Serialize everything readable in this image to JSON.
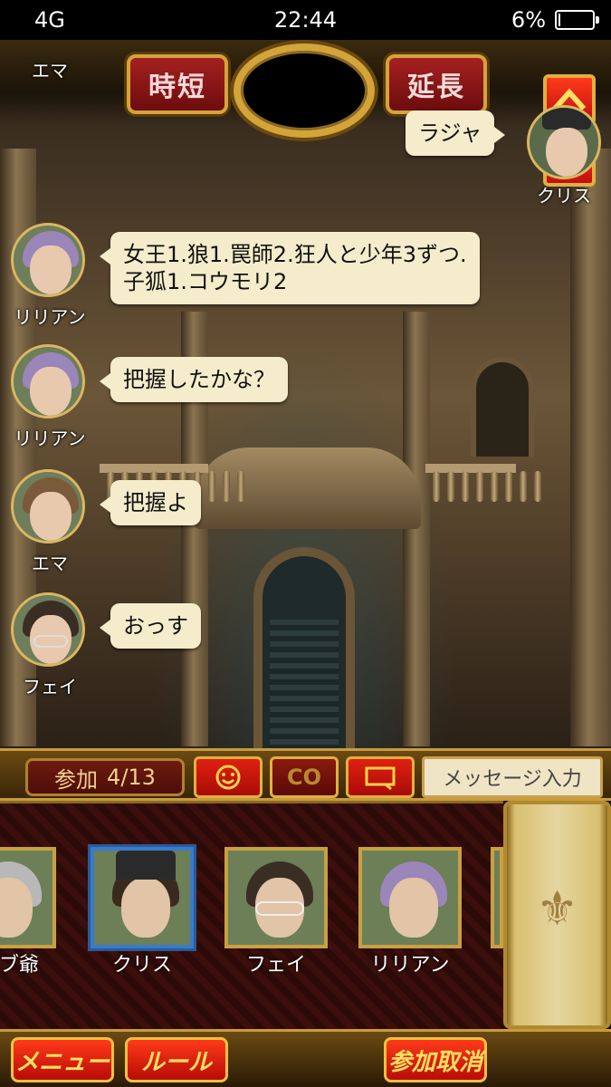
{
  "status_bar": {
    "signal": "4G",
    "time": "22:44",
    "battery_percent_label": "6%",
    "battery_level": 0.06
  },
  "top_controls": {
    "shorten_label": "時短",
    "extend_label": "延長"
  },
  "chat": {
    "top_sender": "エマ",
    "right_message": {
      "text": "ラジャ",
      "sender": "クリス"
    },
    "messages": [
      {
        "sender": "リリアン",
        "lines": [
          "女王1.狼1.罠師2.狂人と少年3ずつ.",
          "子狐1.コウモリ2"
        ]
      },
      {
        "sender": "リリアン",
        "lines": [
          "把握したかな？"
        ]
      },
      {
        "sender": "エマ",
        "lines": [
          "把握よ"
        ]
      },
      {
        "sender": "フェイ",
        "lines": [
          "おっす"
        ]
      }
    ]
  },
  "action_bar": {
    "join_label": "参加",
    "join_count": "4/13",
    "emoji_icon": "smiley-icon",
    "co_label": "CO",
    "frame_icon": "speech-frame-icon",
    "message_placeholder": "メッセージ入力"
  },
  "players": [
    {
      "name": "ブ爺",
      "selected": false
    },
    {
      "name": "クリス",
      "selected": true
    },
    {
      "name": "フェイ",
      "selected": false
    },
    {
      "name": "リリアン",
      "selected": false
    }
  ],
  "bottom_bar": {
    "menu_label": "メニュー",
    "rules_label": "ルール",
    "cancel_join_label": "参加取消"
  },
  "colors": {
    "accent_gold": "#d4a43a",
    "button_red": "#c01010",
    "bubble": "#f4ecca"
  }
}
